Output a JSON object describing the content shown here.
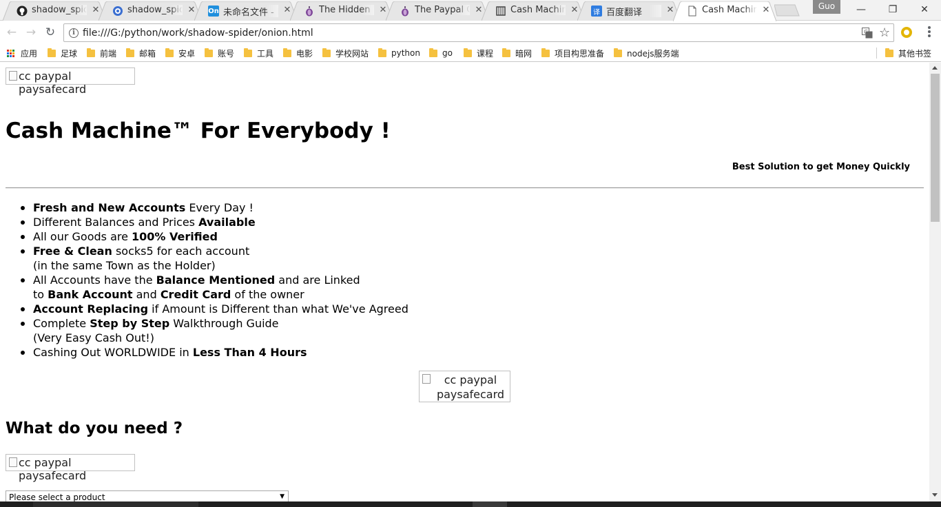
{
  "browser": {
    "tabs": [
      {
        "title": "shadow_spider",
        "icon": "github-icon",
        "active": false
      },
      {
        "title": "shadow_spider",
        "icon": "blue-circle-icon",
        "active": false
      },
      {
        "title": "未命名文件 - ProcessOn",
        "icon": "processon-icon",
        "active": false
      },
      {
        "title": "The Hidden Wiki",
        "icon": "tor-onion-icon",
        "active": false
      },
      {
        "title": "The Paypal Cash",
        "icon": "tor-onion-icon",
        "active": false
      },
      {
        "title": "Cash Machine",
        "icon": "book-icon",
        "active": false
      },
      {
        "title": "百度翻译",
        "icon": "baidu-translate-icon",
        "active": false
      },
      {
        "title": "Cash Machine",
        "icon": "page-icon",
        "active": true
      }
    ],
    "profile_name": "Guo",
    "address": "file:///G:/python/work/shadow-spider/onion.html",
    "bookmarks": [
      "应用",
      "足球",
      "前端",
      "邮箱",
      "安卓",
      "账号",
      "工具",
      "电影",
      "学校网站",
      "python",
      "go",
      "课程",
      "暗网",
      "项目构思准备",
      "nodejs服务端"
    ],
    "other_bookmarks": "其他书签"
  },
  "page": {
    "image_alt": "cc paypal paysafecard",
    "heading": "Cash Machine™ For Everybody !",
    "tagline": "Best Solution to get Money Quickly",
    "features": [
      {
        "b1": "Fresh and New Accounts",
        "t1": " Every Day !"
      },
      {
        "t1": "Different Balances and Prices ",
        "b1": "Available"
      },
      {
        "t1": "All our Goods are ",
        "b1": "100% Verified"
      },
      {
        "b1": "Free & Clean",
        "t1": " socks5 for each account",
        "line2": "(in the same Town as the Holder)"
      },
      {
        "t1": "All Accounts have the ",
        "b1": "Balance Mentioned",
        "t2": " and are Linked",
        "line2a": "to ",
        "line2b": "Bank Account",
        "line2c": " and ",
        "line2d": "Credit Card",
        "line2e": " of the owner"
      },
      {
        "b1": "Account Replacing",
        "t1": " if Amount is Different than what We've Agreed"
      },
      {
        "t1": "Complete ",
        "b1": "Step by Step",
        "t2": " Walkthrough Guide",
        "line2": "(Very Easy Cash Out!)"
      },
      {
        "t1": "Cashing Out WORLDWIDE in ",
        "b1": "Less Than 4 Hours"
      }
    ],
    "subheading": "What do you need ?",
    "select_value": "Please select a product"
  },
  "colors": {
    "tab_bg": "#f2f2f2",
    "bookmark_folder": "#f5c13f",
    "ext_ring": "#e3b505"
  }
}
